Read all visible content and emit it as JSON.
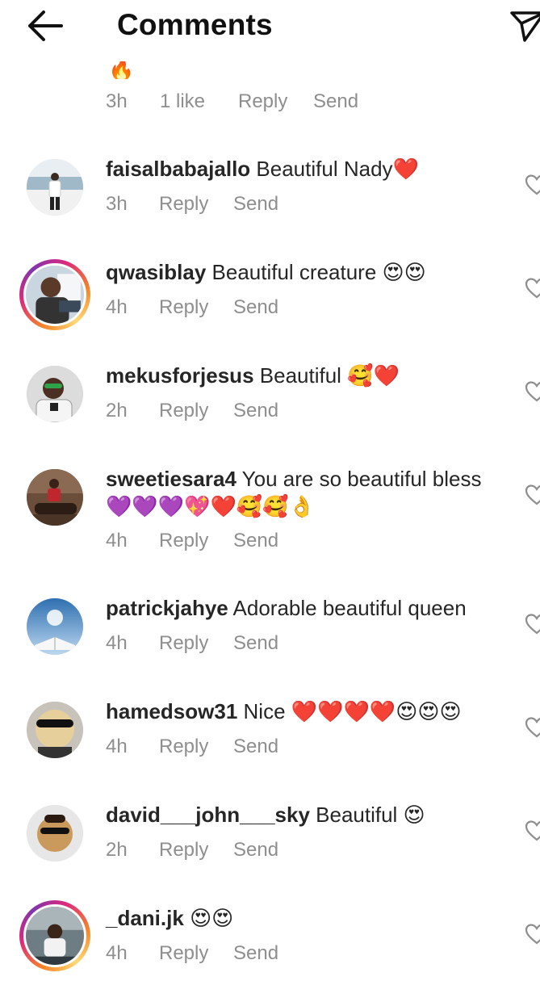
{
  "header": {
    "title": "Comments"
  },
  "previous_comment": {
    "partial_emoji": "🔥",
    "time": "3h",
    "likes": "1 like",
    "reply_label": "Reply",
    "send_label": "Send"
  },
  "comments": [
    {
      "username": "faisalbabajallo",
      "text": "Beautiful Nady❤️",
      "time": "3h",
      "reply_label": "Reply",
      "send_label": "Send",
      "story_ring": false
    },
    {
      "username": "qwasiblay",
      "text": "Beautiful creature 😍😍",
      "time": "4h",
      "reply_label": "Reply",
      "send_label": "Send",
      "story_ring": true
    },
    {
      "username": "mekusforjesus",
      "text": "Beautiful 🥰❤️",
      "time": "2h",
      "reply_label": "Reply",
      "send_label": "Send",
      "story_ring": false
    },
    {
      "username": "sweetiesara4",
      "text": "You are so beautiful bless 💜💜💜💖❤️🥰🥰👌",
      "time": "4h",
      "reply_label": "Reply",
      "send_label": "Send",
      "story_ring": false
    },
    {
      "username": "patrickjahye",
      "text": "Adorable beautiful queen",
      "time": "4h",
      "reply_label": "Reply",
      "send_label": "Send",
      "story_ring": false
    },
    {
      "username": "hamedsow31",
      "text": "Nice ❤️❤️❤️❤️😍😍😍",
      "time": "4h",
      "reply_label": "Reply",
      "send_label": "Send",
      "story_ring": false
    },
    {
      "username": "david___john___sky",
      "text": "Beautiful 😍",
      "time": "2h",
      "reply_label": "Reply",
      "send_label": "Send",
      "story_ring": false
    },
    {
      "username": "_dani.jk",
      "text": "😍😍",
      "time": "4h",
      "reply_label": "Reply",
      "send_label": "Send",
      "story_ring": true
    }
  ],
  "icons": {
    "back": "arrow-left-icon",
    "direct": "paper-plane-icon",
    "like": "heart-outline-icon"
  },
  "colors": {
    "text": "#262626",
    "meta": "#8e8e8e",
    "story_ring_start": "#f58529",
    "story_ring_mid": "#dd2a7b",
    "story_ring_end": "#8134af"
  }
}
